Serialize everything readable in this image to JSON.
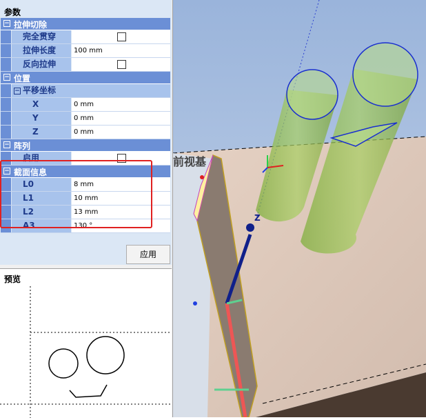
{
  "panel": {
    "title": "参数"
  },
  "groups": [
    {
      "label": "拉伸切除",
      "rows": [
        {
          "name": "完全贯穿",
          "type": "check",
          "checked": false
        },
        {
          "name": "拉伸长度",
          "type": "text",
          "value": "100 mm"
        },
        {
          "name": "反向拉伸",
          "type": "check",
          "checked": false
        }
      ]
    },
    {
      "label": "位置",
      "subgroup": "平移坐标",
      "rows": [
        {
          "name": "X",
          "type": "text",
          "value": "0 mm"
        },
        {
          "name": "Y",
          "type": "text",
          "value": "0 mm"
        },
        {
          "name": "Z",
          "type": "text",
          "value": "0 mm"
        }
      ]
    },
    {
      "label": "阵列",
      "rows": [
        {
          "name": "启用",
          "type": "check",
          "checked": false
        }
      ]
    },
    {
      "label": "截面信息",
      "rows": [
        {
          "name": "L0",
          "type": "text",
          "value": "8 mm"
        },
        {
          "name": "L1",
          "type": "text",
          "value": "10 mm"
        },
        {
          "name": "L2",
          "type": "text",
          "value": "13 mm"
        },
        {
          "name": "A3",
          "type": "text",
          "value": "130 °"
        }
      ]
    }
  ],
  "apply_label": "应用",
  "preview": {
    "title": "预览"
  },
  "viewport": {
    "overlay_text": "前视基",
    "axis_label": "Z"
  },
  "colors": {
    "category": "#6b8fd6",
    "name_cell": "#a8c3ec",
    "highlight": "#e02020",
    "cylinder": "#8fbf4a"
  }
}
